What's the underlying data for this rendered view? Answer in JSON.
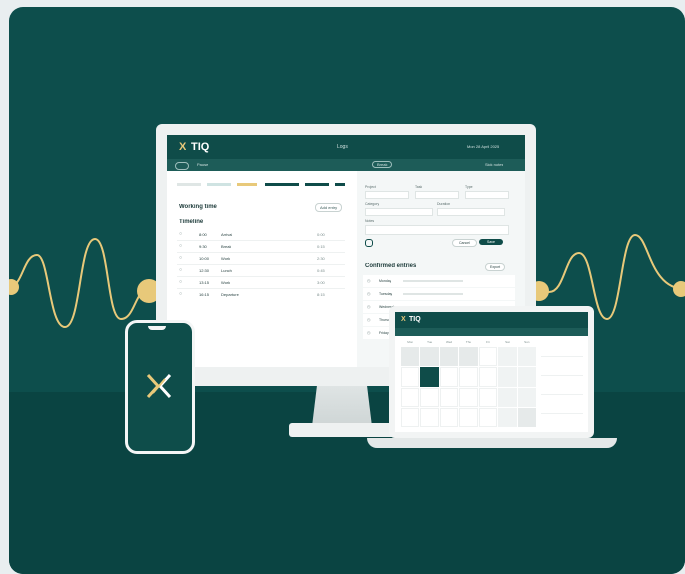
{
  "colors": {
    "brand_dark": "#0d4e4c",
    "brand_gold": "#e8c97a",
    "screen_bg": "#ffffff",
    "muted": "#9aa8a7"
  },
  "logo": {
    "glyph": "X",
    "name": "TIQ"
  },
  "monitor": {
    "nav_center": "Logs",
    "nav_right": "Mon 28 April 2025",
    "sub_left": "Pause",
    "sub_mid": "Break",
    "sub_right": "Sick notes",
    "working_time_title": "Working time",
    "working_time_button": "Add entry",
    "timeline_title": "Timeline",
    "timeline_rows": [
      {
        "time": "8:00",
        "text": "Arrival",
        "dur": "0:00"
      },
      {
        "time": "9:30",
        "text": "Break",
        "dur": "0:15"
      },
      {
        "time": "10:00",
        "text": "Work",
        "dur": "2:30"
      },
      {
        "time": "12:30",
        "text": "Lunch",
        "dur": "0:45"
      },
      {
        "time": "13:15",
        "text": "Work",
        "dur": "3:00"
      },
      {
        "time": "16:15",
        "text": "Departure",
        "dur": "8:15"
      }
    ],
    "form_labels": [
      "Project",
      "Task",
      "Type",
      "Category",
      "Duration",
      "Notes"
    ],
    "form_cancel": "Cancel",
    "form_submit": "Save",
    "confirmed_title": "Confirmed entries",
    "confirmed_button": "Export",
    "confirmed_rows": [
      "Monday",
      "Tuesday",
      "Wednesday",
      "Thursday",
      "Friday"
    ]
  },
  "laptop": {
    "logo_name": "TIQ",
    "calendar_days": [
      "Mon",
      "Tue",
      "Wed",
      "Thu",
      "Fri",
      "Sat",
      "Sun"
    ]
  }
}
